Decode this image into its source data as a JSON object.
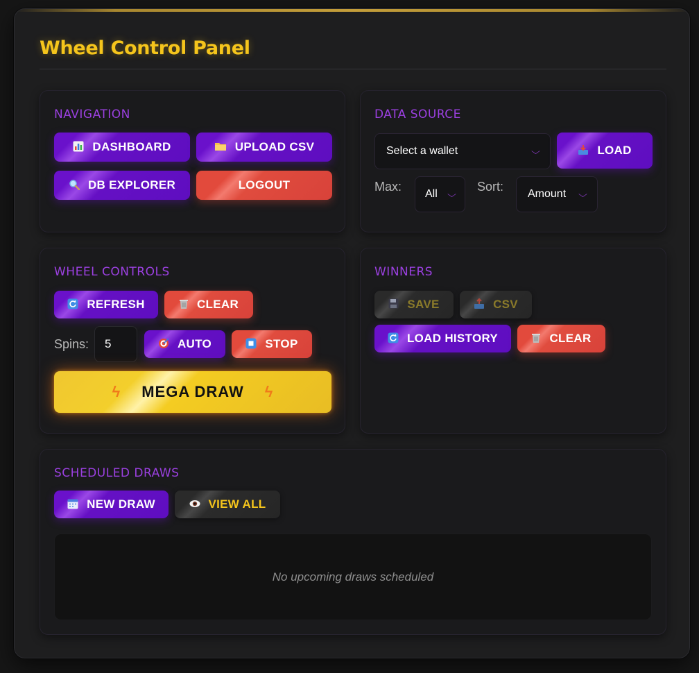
{
  "title": "Wheel Control Panel",
  "navigation": {
    "title": "NAVIGATION",
    "dashboard": "DASHBOARD",
    "upload_csv": "UPLOAD CSV",
    "db_explorer": "DB EXPLORER",
    "logout": "LOGOUT"
  },
  "data_source": {
    "title": "DATA SOURCE",
    "wallet_select": "Select a wallet",
    "load": "LOAD",
    "max_label": "Max:",
    "max_value": "All",
    "sort_label": "Sort:",
    "sort_value": "Amount"
  },
  "wheel_controls": {
    "title": "WHEEL CONTROLS",
    "refresh": "REFRESH",
    "clear": "CLEAR",
    "spins_label": "Spins:",
    "spins_value": "5",
    "auto": "AUTO",
    "stop": "STOP",
    "mega_draw": "MEGA DRAW"
  },
  "winners": {
    "title": "WINNERS",
    "save": "SAVE",
    "csv": "CSV",
    "load_history": "LOAD HISTORY",
    "clear": "CLEAR"
  },
  "scheduled_draws": {
    "title": "SCHEDULED DRAWS",
    "new_draw": "NEW DRAW",
    "view_all": "VIEW ALL",
    "empty_message": "No upcoming draws scheduled"
  },
  "colors": {
    "accent_gold": "#f5c51c",
    "accent_purple": "#6a11cb",
    "danger_red": "#e24a3c",
    "section_title": "#9b40e0"
  },
  "icons": {
    "dashboard": "bar-chart-icon",
    "upload_csv": "folder-icon",
    "db_explorer": "magnifier-icon",
    "load": "inbox-tray-icon",
    "refresh": "refresh-icon",
    "clear": "wastebasket-icon",
    "auto": "target-icon",
    "stop": "stop-icon",
    "mega": "lightning-icon",
    "save": "floppy-disk-icon",
    "csv": "outbox-tray-icon",
    "new_draw": "calendar-icon",
    "view_all": "eye-icon"
  }
}
